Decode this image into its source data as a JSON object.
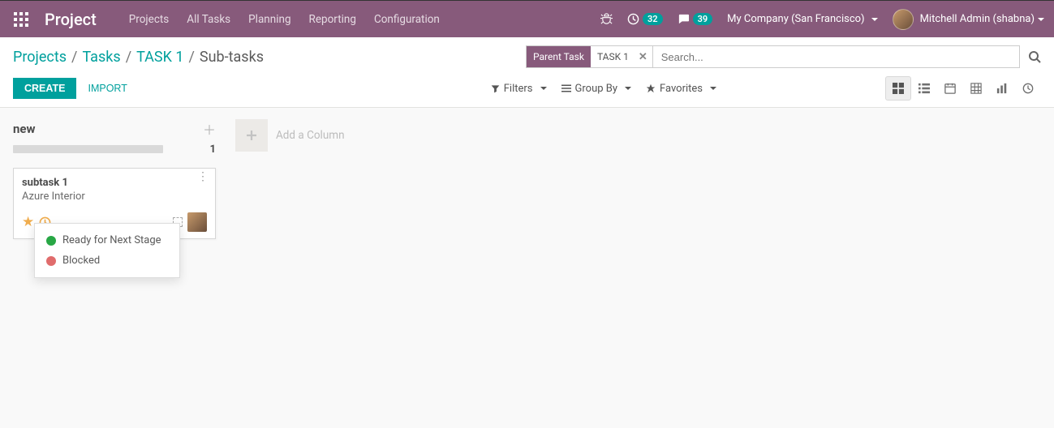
{
  "brand": "Project",
  "nav": {
    "projects": "Projects",
    "all_tasks": "All Tasks",
    "planning": "Planning",
    "reporting": "Reporting",
    "configuration": "Configuration"
  },
  "header": {
    "activities_count": "32",
    "discuss_count": "39",
    "company": "My Company (San Francisco)",
    "user": "Mitchell Admin (shabna)"
  },
  "breadcrumb": {
    "l1": "Projects",
    "l2": "Tasks",
    "l3": "TASK 1",
    "current": "Sub-tasks"
  },
  "search": {
    "facet_label": "Parent Task",
    "facet_value": "TASK 1",
    "placeholder": "Search..."
  },
  "buttons": {
    "create": "CREATE",
    "import": "IMPORT"
  },
  "filters": {
    "filters": "Filters",
    "group_by": "Group By",
    "favorites": "Favorites"
  },
  "kanban": {
    "column_title": "new",
    "column_count": "1",
    "add_column": "Add a Column"
  },
  "card": {
    "title": "subtask 1",
    "subtitle": "Azure Interior"
  },
  "state_menu": {
    "ready": "Ready for Next Stage",
    "blocked": "Blocked"
  }
}
